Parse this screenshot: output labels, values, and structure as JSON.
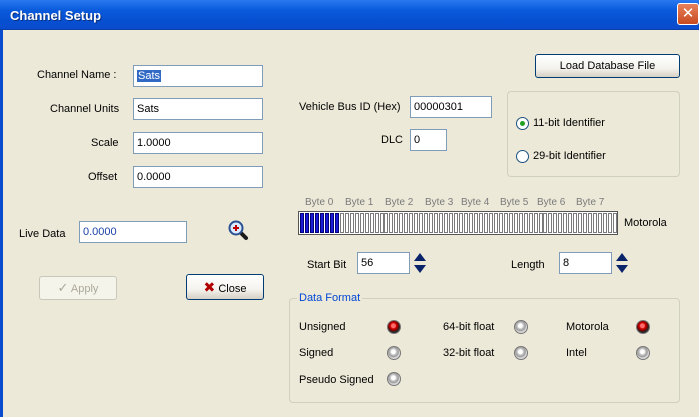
{
  "window": {
    "title": "Channel Setup",
    "close_glyph": "✕"
  },
  "form": {
    "channel_name_label": "Channel Name :",
    "channel_name_value": "Sats",
    "channel_units_label": "Channel Units",
    "channel_units_value": "Sats",
    "scale_label": "Scale",
    "scale_value": "1.0000",
    "offset_label": "Offset",
    "offset_value": "0.0000",
    "live_data_label": "Live Data",
    "live_data_value": "0.0000"
  },
  "buttons": {
    "apply": "Apply",
    "close": "Close",
    "load_db": "Load Database File"
  },
  "bus": {
    "vehicle_bus_id_label": "Vehicle Bus ID (Hex)",
    "vehicle_bus_id_value": "00000301",
    "dlc_label": "DLC",
    "dlc_value": "0",
    "id11_label": "11-bit Identifier",
    "id29_label": "29-bit Identifier",
    "selected_identifier": "11-bit Identifier"
  },
  "bits": {
    "byte_labels": [
      "Byte 0",
      "Byte 1",
      "Byte 2",
      "Byte 3",
      "Byte 4",
      "Byte 5",
      "Byte 6",
      "Byte 7"
    ],
    "order_label": "Motorola",
    "start_bit_label": "Start Bit",
    "start_bit_value": "56",
    "length_label": "Length",
    "length_value": "8",
    "active_color": "#1a1ad6"
  },
  "data_format": {
    "title": "Data Format",
    "options": {
      "unsigned": "Unsigned",
      "signed": "Signed",
      "pseudo_signed": "Pseudo Signed",
      "float64": "64-bit float",
      "float32": "32-bit float",
      "motorola": "Motorola",
      "intel": "Intel"
    },
    "selected": [
      "Unsigned",
      "Motorola"
    ]
  },
  "colors": {
    "title_bar": "#0a5bdb",
    "dialog_bg": "#ece9d8",
    "group_title": "#0046d5",
    "indicator_on": "#d00000"
  }
}
